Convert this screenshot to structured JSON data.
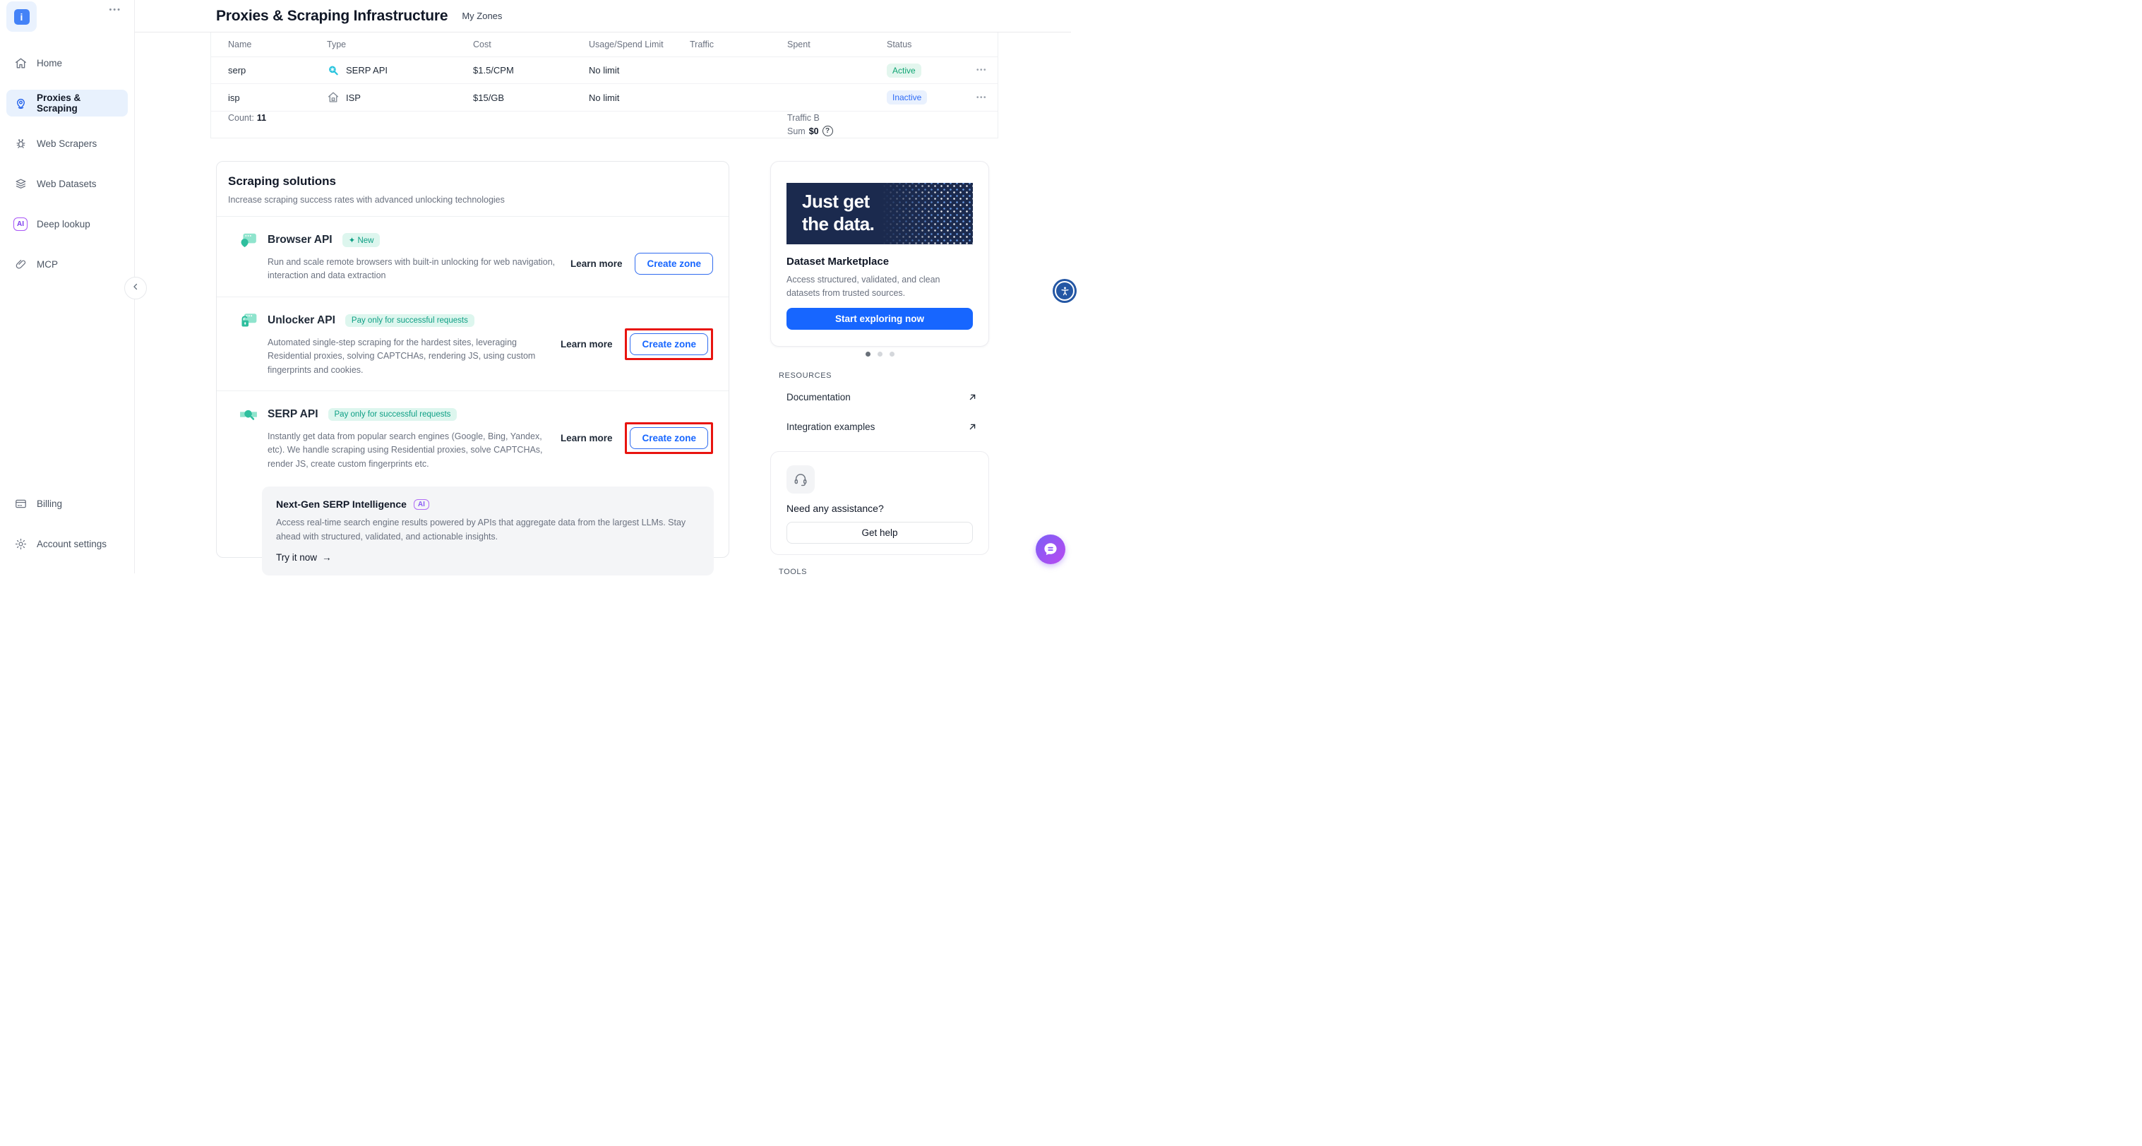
{
  "sidebar": {
    "logo_letter": "i",
    "menu_ellipsis": "•••",
    "items": [
      "Home",
      "Proxies & Scraping",
      "Web Scrapers",
      "Web Datasets",
      "Deep lookup",
      "MCP"
    ],
    "deep_lookup_badge": "AI",
    "bottom_items": [
      "Billing",
      "Account settings"
    ]
  },
  "header": {
    "title": "Proxies & Scraping Infrastructure",
    "tab": "My Zones"
  },
  "table": {
    "columns": [
      "Name",
      "Type",
      "Cost",
      "Usage/Spend Limit",
      "Traffic",
      "Spent",
      "Status"
    ],
    "rows": [
      {
        "name": "serp",
        "type": "SERP API",
        "cost": "$1.5/CPM",
        "limit": "No limit",
        "status": "Active"
      },
      {
        "name": "isp",
        "type": "ISP",
        "cost": "$15/GB",
        "limit": "No limit",
        "status": "Inactive"
      }
    ],
    "row_actions": "•••",
    "footer": {
      "count_label": "Count:",
      "count_value": "11",
      "traffic_total": "Traffic B",
      "sum_label": "Sum",
      "sum_value": "$0",
      "sum_help": "?"
    }
  },
  "solutions": {
    "title": "Scraping solutions",
    "subtitle": "Increase scraping success rates with advanced unlocking technologies",
    "items": [
      {
        "name": "Browser API",
        "badge_icon": "✦",
        "badge": "New",
        "description": "Run and scale remote browsers with built-in unlocking for web navigation, interaction and data extraction",
        "learn_more": "Learn more",
        "create": "Create zone"
      },
      {
        "name": "Unlocker API",
        "badge": "Pay only for successful requests",
        "description": "Automated single-step scraping for the hardest sites, leveraging Residential proxies, solving CAPTCHAs, rendering JS, using custom fingerprints and cookies.",
        "learn_more": "Learn more",
        "create": "Create zone"
      },
      {
        "name": "SERP API",
        "badge": "Pay only for successful requests",
        "description": "Instantly get data from popular search engines (Google, Bing, Yandex, etc). We handle scraping using Residential proxies, solve CAPTCHAs, render JS, create custom fingerprints etc.",
        "learn_more": "Learn more",
        "create": "Create zone"
      }
    ],
    "serp_intelligence": {
      "title": "Next-Gen SERP Intelligence",
      "badge": "AI",
      "description": "Access real-time search engine results powered by APIs that aggregate data from the largest LLMs. Stay ahead with structured, validated, and actionable insights.",
      "cta": "Try it now",
      "cta_arrow": "→"
    }
  },
  "promo": {
    "banner_line1": "Just get",
    "banner_line2": "the data.",
    "title": "Dataset Marketplace",
    "description": "Access structured, validated, and clean datasets from trusted sources.",
    "cta": "Start exploring now"
  },
  "resources": {
    "title": "RESOURCES",
    "links": [
      "Documentation",
      "Integration examples"
    ]
  },
  "help": {
    "question": "Need any assistance?",
    "cta": "Get help"
  },
  "tools_label": "TOOLS",
  "colors": {
    "accent_blue": "#1766ff",
    "teal": "#2fbf9e",
    "teal_light": "#8fe4cd",
    "badge_teal_text": "#0d9f84",
    "active_green": "#0fa573",
    "inactive_blue": "#2e6bf6",
    "annotation_red": "#e8140f",
    "banner_navy": "#1b2a4e",
    "purple": "#8b5cf6",
    "sidebar_active_bg": "#e8f1fd",
    "serp_icon_cyan": "#29c4de"
  }
}
